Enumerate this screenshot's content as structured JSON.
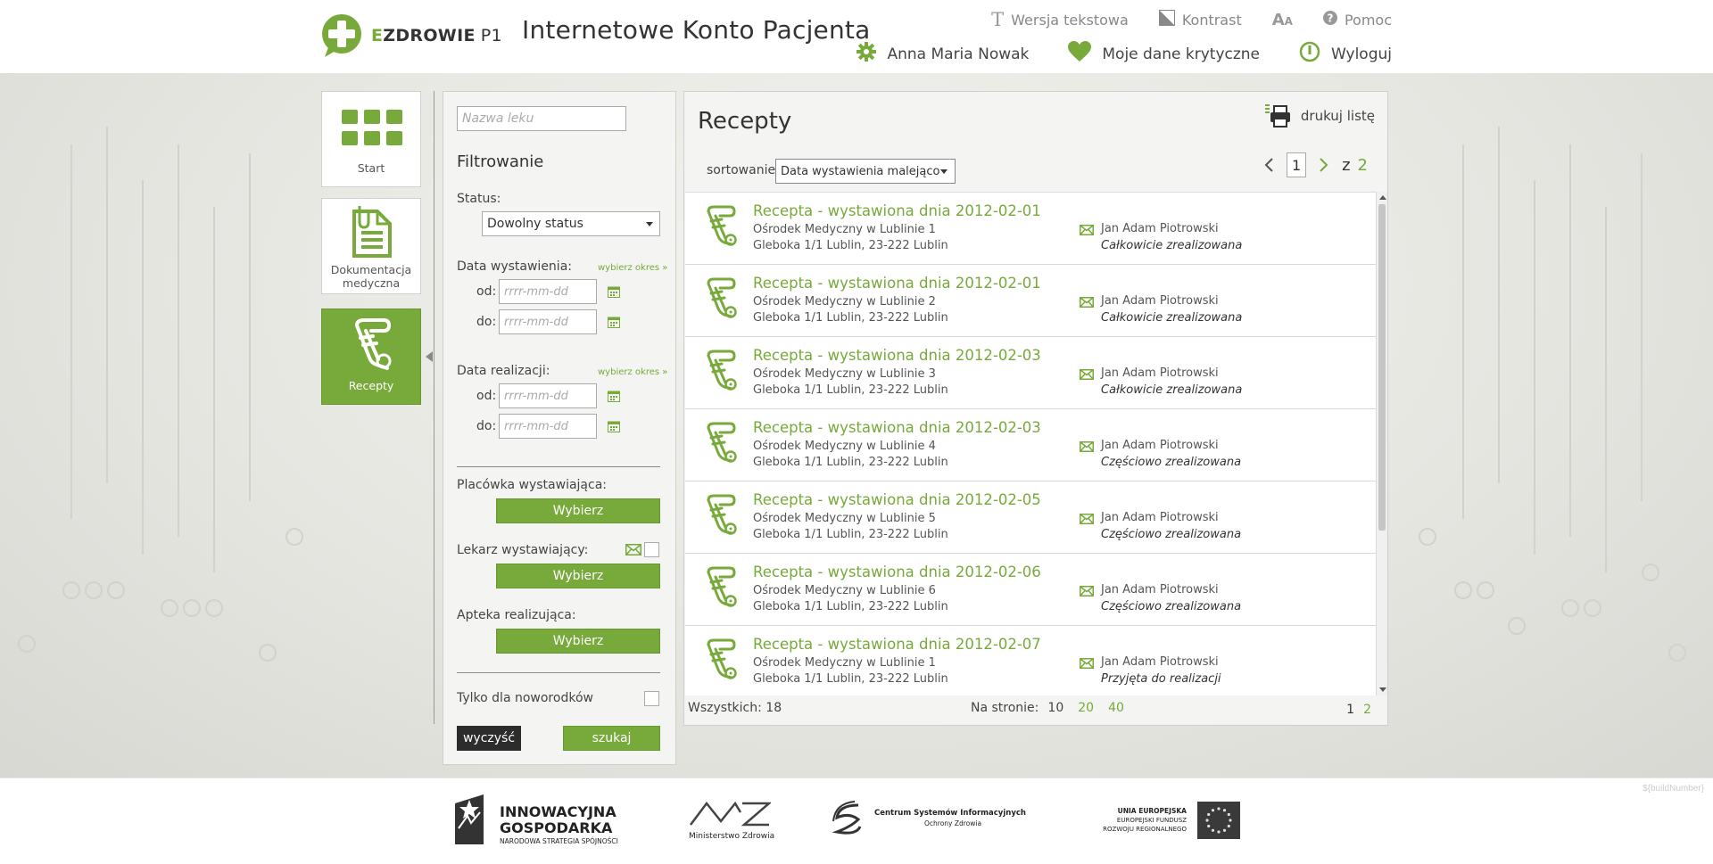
{
  "header": {
    "logo_prefix": "E",
    "logo_text": "ZDROWIE",
    "logo_suffix": "P1",
    "app_title": "Internetowe Konto Pacjenta",
    "top_links": [
      {
        "label": "Wersja tekstowa",
        "icon": "text-version-icon"
      },
      {
        "label": "Kontrast",
        "icon": "contrast-icon"
      },
      {
        "label": "",
        "icon": "font-size-icon"
      },
      {
        "label": "Pomoc",
        "icon": "help-icon"
      }
    ],
    "user_name": "Anna Maria Nowak",
    "critical_data": "Moje dane krytyczne",
    "logout": "Wyloguj"
  },
  "nav": {
    "items": [
      {
        "label": "Start",
        "icon": "grid-icon"
      },
      {
        "label": "Dokumentacja medyczna",
        "icon": "document-icon"
      },
      {
        "label": "Recepty",
        "icon": "prescription-icon",
        "active": true
      }
    ]
  },
  "filter": {
    "drug_placeholder": "Nazwa leku",
    "title": "Filtrowanie",
    "status_label": "Status:",
    "status_value": "Dowolny status",
    "issue_date_label": "Data wystawienia:",
    "range_link": "wybierz okres »",
    "from_label": "od:",
    "to_label": "do:",
    "date_placeholder": "rrrr-mm-dd",
    "realization_date_label": "Data realizacji:",
    "facility_label": "Placówka wystawiająca:",
    "doctor_label": "Lekarz wystawiający:",
    "pharmacy_label": "Apteka realizująca:",
    "choose_label": "Wybierz",
    "newborns_label": "Tylko dla noworodków",
    "clear_label": "wyczyść",
    "search_label": "szukaj"
  },
  "main": {
    "title": "Recepty",
    "print_label": "drukuj listę",
    "sort_label": "sortowanie",
    "sort_value": "Data wystawienia malejąco",
    "page_current": "1",
    "page_of": "z",
    "page_total": "2",
    "rows": [
      {
        "title": "Recepta - wystawiona dnia 2012-02-01",
        "place": "Ośrodek Medyczny w Lublinie 1",
        "address": "Gleboka 1/1 Lublin, 23-222 Lublin",
        "doctor": "Jan Adam Piotrowski",
        "status": "Całkowicie zrealizowana"
      },
      {
        "title": "Recepta - wystawiona dnia 2012-02-01",
        "place": "Ośrodek Medyczny w Lublinie 2",
        "address": "Gleboka 1/1 Lublin, 23-222 Lublin",
        "doctor": "Jan Adam Piotrowski",
        "status": "Całkowicie zrealizowana"
      },
      {
        "title": "Recepta - wystawiona dnia 2012-02-03",
        "place": "Ośrodek Medyczny w Lublinie 3",
        "address": "Gleboka 1/1 Lublin, 23-222 Lublin",
        "doctor": "Jan Adam Piotrowski",
        "status": "Całkowicie zrealizowana"
      },
      {
        "title": "Recepta - wystawiona dnia 2012-02-03",
        "place": "Ośrodek Medyczny w Lublinie 4",
        "address": "Gleboka 1/1 Lublin, 23-222 Lublin",
        "doctor": "Jan Adam Piotrowski",
        "status": "Częściowo zrealizowana"
      },
      {
        "title": "Recepta - wystawiona dnia 2012-02-05",
        "place": "Ośrodek Medyczny w Lublinie 5",
        "address": "Gleboka 1/1 Lublin, 23-222 Lublin",
        "doctor": "Jan Adam Piotrowski",
        "status": "Częściowo zrealizowana"
      },
      {
        "title": "Recepta - wystawiona dnia 2012-02-06",
        "place": "Ośrodek Medyczny w Lublinie 6",
        "address": "Gleboka 1/1 Lublin, 23-222 Lublin",
        "doctor": "Jan Adam Piotrowski",
        "status": "Częściowo zrealizowana"
      },
      {
        "title": "Recepta - wystawiona dnia 2012-02-07",
        "place": "Ośrodek Medyczny w Lublinie 1",
        "address": "Gleboka 1/1 Lublin, 23-222 Lublin",
        "doctor": "Jan Adam Piotrowski",
        "status": "Przyjęta do realizacji"
      }
    ],
    "total_label": "Wszystkich: 18",
    "per_page_label": "Na stronie:",
    "per_page_options": [
      "10",
      "20",
      "40"
    ],
    "pages": [
      "1",
      "2"
    ]
  },
  "footer": {
    "build": "${buildNumber}",
    "logo1_line1": "INNOWACYJNA",
    "logo1_line2": "GOSPODARKA",
    "logo1_line3": "NARODOWA STRATEGIA SPÓJNOŚCI",
    "logo2": "Ministerstwo Zdrowia",
    "logo3_line1": "Centrum Systemów Informacyjnych",
    "logo3_line2": "Ochrony Zdrowia",
    "logo4_line1": "UNIA EUROPEJSKA",
    "logo4_line2": "EUROPEJSKI FUNDUSZ",
    "logo4_line3": "ROZWOJU REGIONALNEGO"
  },
  "colors": {
    "accent": "#77aa3a",
    "dark_button": "#2c2c2c"
  }
}
